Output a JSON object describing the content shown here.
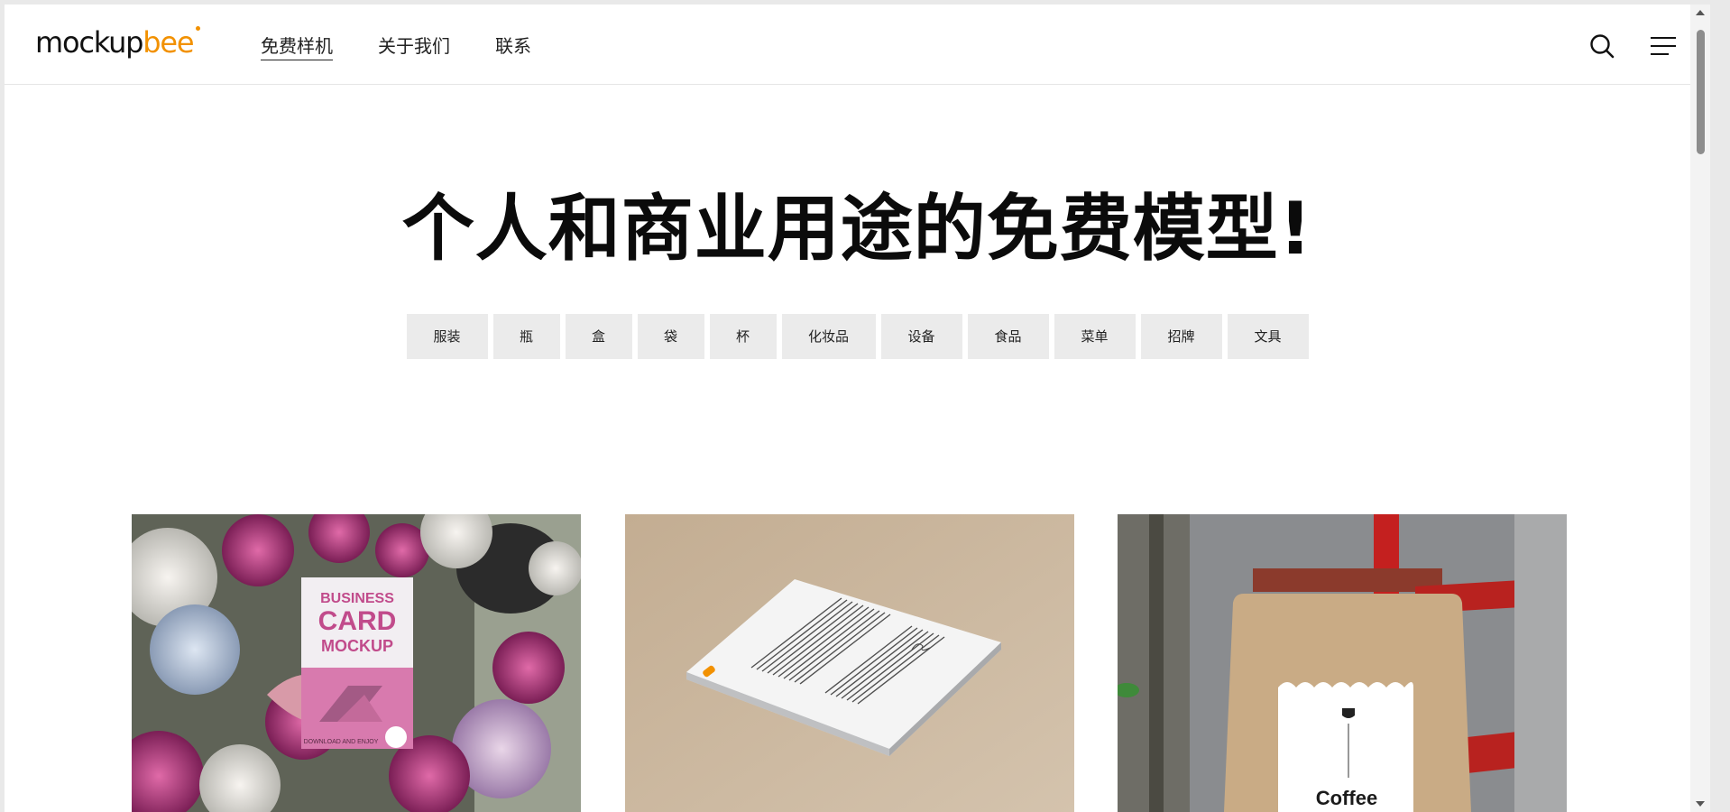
{
  "header": {
    "logo_main": "mockup",
    "logo_accent": "bee",
    "nav": [
      "免费样机",
      "关于我们",
      "联系"
    ],
    "search_icon": "search-icon",
    "menu_icon": "hamburger-menu-icon"
  },
  "hero": {
    "title": "个人和商业用途的免费模型!",
    "tags": [
      "服装",
      "瓶",
      "盒",
      "袋",
      "杯",
      "化妆品",
      "设备",
      "食品",
      "菜单",
      "招牌",
      "文具"
    ]
  },
  "cards": [
    {
      "line1": "BUSINESS",
      "line2": "CARD",
      "line3": "MOCKUP",
      "footer": "DOWNLOAD AND ENJOY"
    },
    {
      "subject": "paper-stack-mockup"
    },
    {
      "label": "Coffee"
    }
  ],
  "colors": {
    "accent": "#f29100",
    "tag_bg": "#ebebeb",
    "text": "#111111"
  }
}
